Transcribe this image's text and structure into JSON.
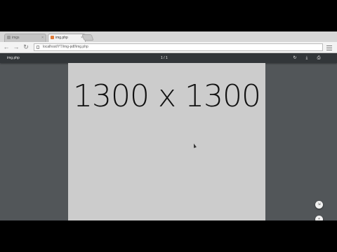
{
  "browser": {
    "tabs": [
      {
        "label": "imgs",
        "active": false
      },
      {
        "label": "img.php",
        "active": true
      }
    ],
    "address": "localhost/YT/img-pdf/img.php"
  },
  "viewer": {
    "title": "img.php",
    "page_indicator": "1 / 1",
    "buttons": {
      "rotate": "↻",
      "download": "⤓",
      "print": "⎙",
      "fit": "⇲",
      "zoom_in": "+",
      "zoom_out": "−"
    },
    "page_content": "1300 x 1300"
  },
  "colors": {
    "viewer_bg": "#525659",
    "toolbar_bg": "#323639",
    "page_bg": "#cccccc"
  }
}
